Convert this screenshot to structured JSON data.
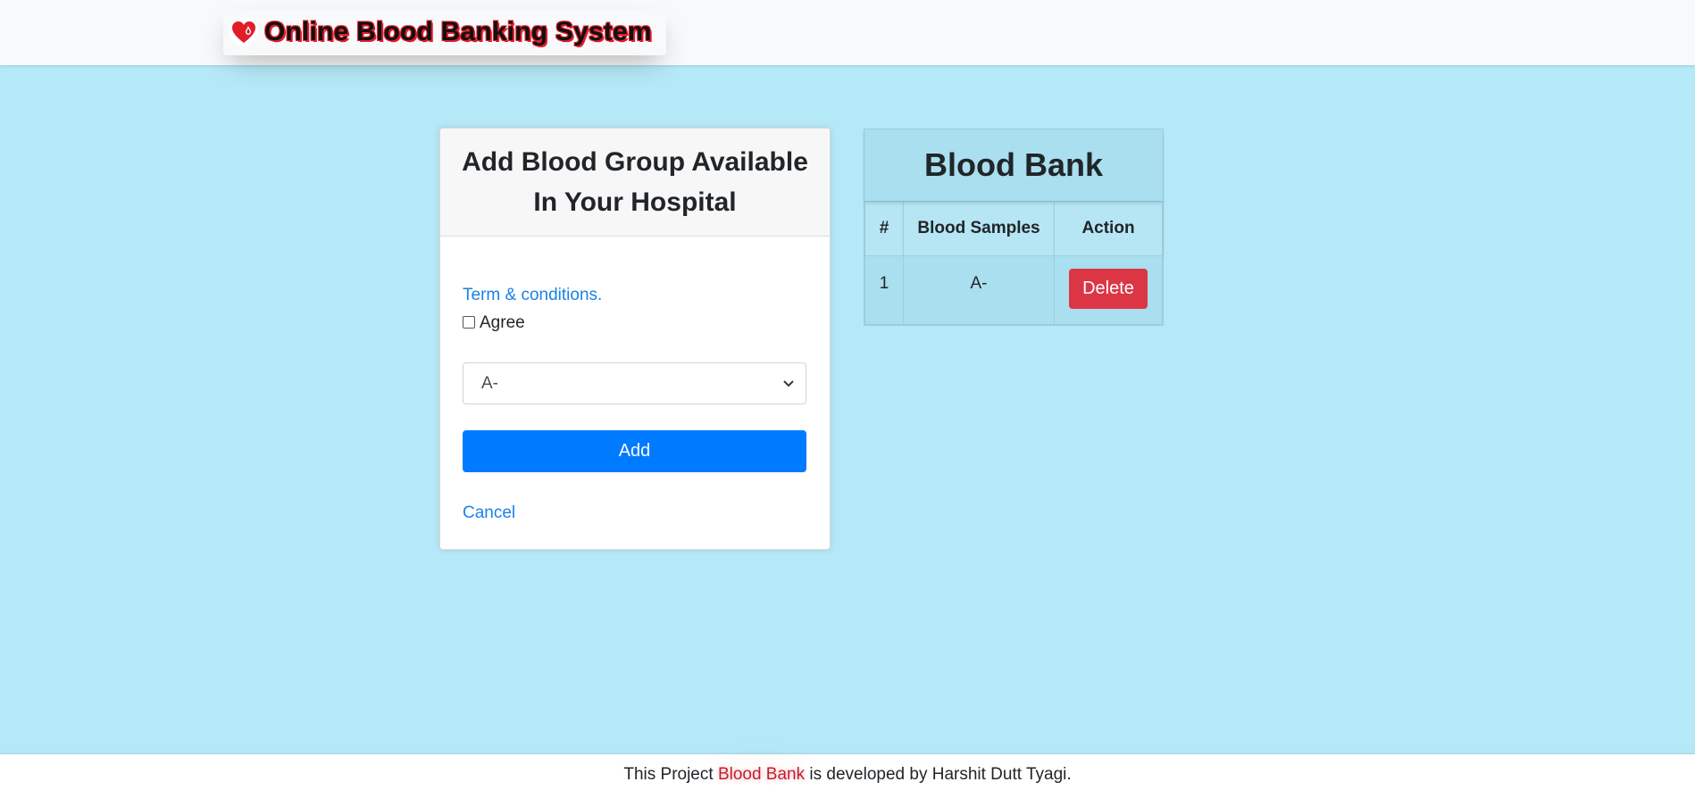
{
  "navbar": {
    "brand_text": "Online Blood Banking System",
    "brand_icon": "blood-drop-heart-icon"
  },
  "form_card": {
    "title": "Add Blood Group Available In Your Hospital",
    "terms_link": "Term & conditions.",
    "agree_label": "Agree",
    "agree_checked": false,
    "select_value": "A-",
    "add_button": "Add",
    "cancel_link": "Cancel"
  },
  "blood_table": {
    "caption": "Blood Bank",
    "headers": [
      "#",
      "Blood Samples",
      "Action"
    ],
    "rows": [
      {
        "index": "1",
        "sample": "A-",
        "action": "Delete"
      }
    ]
  },
  "footer": {
    "prefix": "This Project ",
    "highlight": "Blood Bank",
    "suffix": " is developed by Harshit Dutt Tyagi."
  },
  "colors": {
    "page_background": "#b6e9f8",
    "primary": "#007bff",
    "danger": "#dc3545",
    "link": "#1a82e8",
    "brand_red": "#e11d2a"
  }
}
